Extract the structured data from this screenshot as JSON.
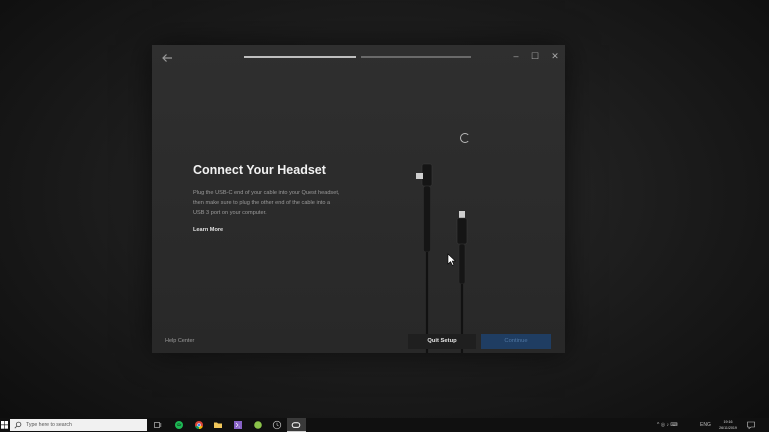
{
  "window": {
    "back_icon": "arrow-left-icon",
    "progress_steps": [
      {
        "step": 1,
        "state": "active",
        "color": "#bfbfbf"
      },
      {
        "step": 2,
        "state": "inactive",
        "color": "#6a6a6a"
      }
    ],
    "controls": {
      "minimize": "–",
      "maximize": "☐",
      "close": "✕"
    }
  },
  "content": {
    "title": "Connect Your Headset",
    "description": "Plug the USB-C end of your cable into your Quest headset, then make sure to plug the other end of the cable into a USB 3 port on your computer.",
    "learn_more": "Learn More",
    "illustration": "usb-c-cable-icon",
    "status_icon": "loading-spinner-icon"
  },
  "footer": {
    "help_center": "Help Center",
    "quit_setup": "Quit Setup",
    "continue": "Continue"
  },
  "colors": {
    "window_bg": "#2b2b2b",
    "primary_button_disabled": "#1f3d62",
    "primary_button_text_disabled": "#4f76a3"
  },
  "taskbar": {
    "search_placeholder": "Type here to search",
    "pinned_apps": [
      "task-view-icon",
      "spotify-icon",
      "chrome-icon",
      "file-explorer-icon",
      "visual-studio-icon",
      "app-icon",
      "clock-app-icon",
      "oculus-icon"
    ],
    "active_app": "oculus-icon",
    "tray_left": "^ ◎ ♪ ⌨",
    "tray_lang": "ENG",
    "clock_time": "19:16",
    "clock_date": "26/11/2019"
  }
}
